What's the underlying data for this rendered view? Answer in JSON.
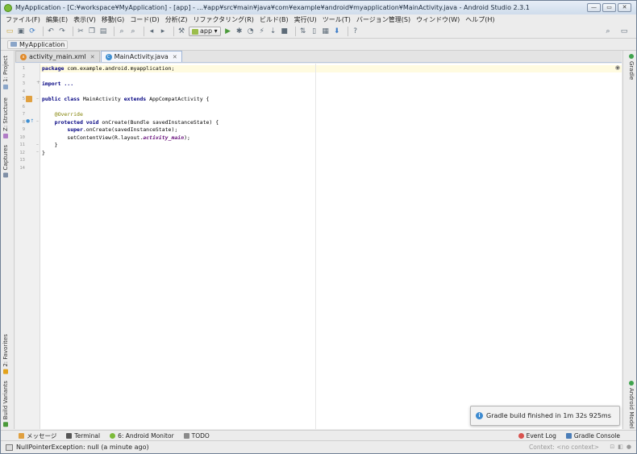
{
  "window": {
    "title": "MyApplication - [C:¥workspace¥MyApplication] - [app] - ...¥app¥src¥main¥java¥com¥example¥android¥myapplication¥MainActivity.java - Android Studio 2.3.1",
    "controls": [
      "minimize",
      "maximize",
      "close"
    ]
  },
  "menu": [
    "ファイル(F)",
    "編集(E)",
    "表示(V)",
    "移動(G)",
    "コード(D)",
    "分析(Z)",
    "リファクタリング(R)",
    "ビルド(B)",
    "実行(U)",
    "ツール(T)",
    "バージョン管理(S)",
    "ウィンドウ(W)",
    "ヘルプ(H)"
  ],
  "toolbar": {
    "run_config": "app"
  },
  "breadcrumb": {
    "project": "MyApplication"
  },
  "left_tabs": {
    "project": "1: Project",
    "structure": "Z: Structure",
    "captures": "Captures",
    "favorites": "2: Favorites",
    "build_variants": "Build Variants"
  },
  "right_tabs": {
    "gradle": "Gradle",
    "android_model": "Android Model"
  },
  "editor_tabs": [
    {
      "label": "activity_main.xml",
      "active": false
    },
    {
      "label": "MainActivity.java",
      "active": true
    }
  ],
  "code": {
    "line_numbers": [
      "1",
      "2",
      "3",
      "4",
      "5",
      "6",
      "7",
      "8",
      "9",
      "10",
      "11",
      "12",
      "13",
      "14"
    ],
    "l1_kw": "package",
    "l1_rest": " com.example.android.myapplication;",
    "l3_kw": "import",
    "l3_rest": " ...",
    "l6_kw": "public class",
    "l6_mid": " MainActivity ",
    "l6_kw2": "extends",
    "l6_rest": " AppCompatActivity {",
    "l8_ann": "    @Override",
    "l9_indent": "    ",
    "l9_kw": "protected void",
    "l9_rest": " onCreate(Bundle savedInstanceState) {",
    "l10_indent": "        ",
    "l10_kw": "super",
    "l10_rest": ".onCreate(savedInstanceState);",
    "l11_pre": "        setContentView(R.layout.",
    "l11_field": "activity_main",
    "l11_post": ");",
    "l12": "    }",
    "l13": "}"
  },
  "notification": {
    "text": "Gradle build finished in 1m 32s 925ms"
  },
  "bottom_tools": {
    "messages": "メッセージ",
    "terminal": "Terminal",
    "android_monitor": "6: Android Monitor",
    "todo": "TODO",
    "event_log": "Event Log",
    "gradle_console": "Gradle Console"
  },
  "status": {
    "message": "NullPointerException: null (a minute ago)",
    "context": "Context: <no context>"
  },
  "colors": {
    "keyword": "#000080",
    "annotation": "#808000",
    "field": "#660e7a",
    "current_line": "#fffbe0",
    "notification_icon": "#3c8ad0"
  }
}
